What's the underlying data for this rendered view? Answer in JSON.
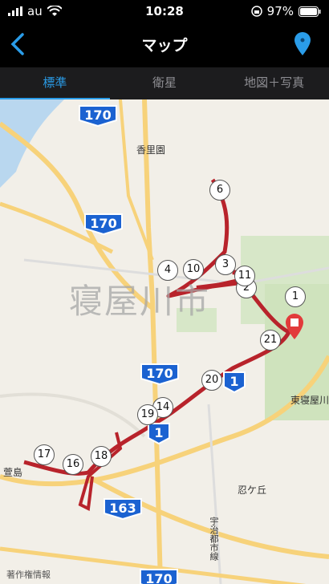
{
  "status": {
    "carrier": "au",
    "time": "10:28",
    "battery": "97%"
  },
  "nav": {
    "title": "マップ"
  },
  "tabs": [
    {
      "label": "標準"
    },
    {
      "label": "衛星"
    },
    {
      "label": "地図＋写真"
    }
  ],
  "map": {
    "city_label": "寝屋川市",
    "places": {
      "korien": "香里園",
      "higashi": "東寝屋川",
      "shinobu": "忍ケ丘",
      "kayashima": "萱島",
      "uzumasa": "宇治都市線"
    },
    "highways": {
      "h1": "170",
      "h2": "170",
      "h3": "170",
      "h4": "1",
      "h5": "1",
      "h6": "163",
      "h7": "170"
    },
    "markers": [
      "1",
      "2",
      "3",
      "4",
      "6",
      "10",
      "11",
      "14",
      "16",
      "17",
      "18",
      "19",
      "20",
      "21"
    ],
    "legal": "著作権情報"
  }
}
